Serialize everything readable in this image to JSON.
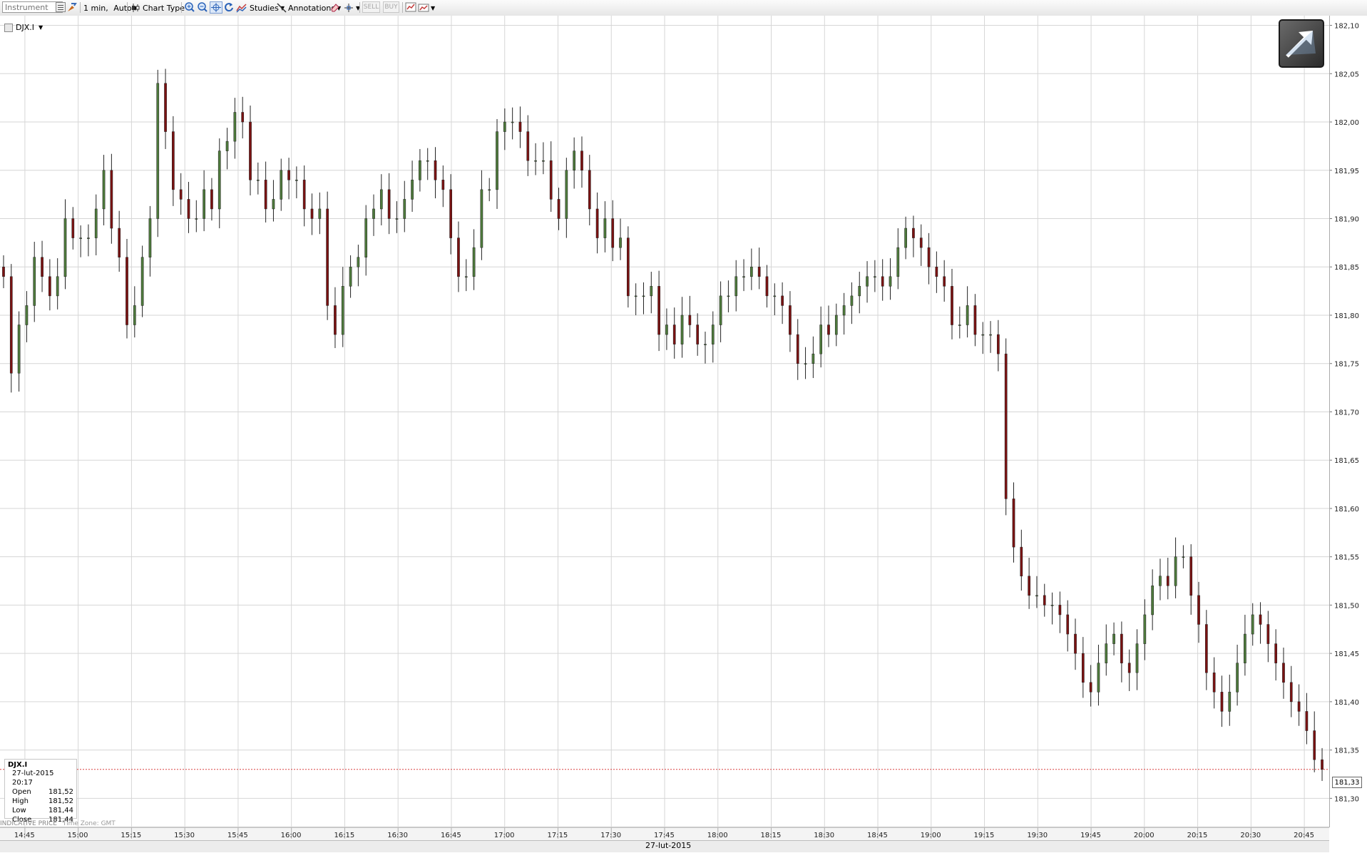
{
  "toolbar": {
    "instrument_placeholder": "Instrument",
    "interval_label": "1 min,",
    "auto_label": "Auto",
    "chart_type_label": "Chart Type",
    "studies_label": "Studies",
    "annotations_label": "Annotations",
    "sell_label": "SELL",
    "buy_label": "BUY"
  },
  "symbol": "DJX.I",
  "info_box": {
    "symbol": "DJX.I",
    "datetime": "27-lut-2015 20:17",
    "rows": [
      {
        "label": "Open",
        "value": "181,52"
      },
      {
        "label": "High",
        "value": "181,52"
      },
      {
        "label": "Low",
        "value": "181,44"
      },
      {
        "label": "Close",
        "value": "181,44"
      }
    ]
  },
  "footer": {
    "note": "INDICATIVE PRICE",
    "timezone": "Time Zone: GMT"
  },
  "date_label": "27-lut-2015",
  "last_price_label": "181,33",
  "colors": {
    "up": "#4e7a3c",
    "down": "#7a1212",
    "grid": "#d6d6d6",
    "last_price_line": "#d94040"
  },
  "chart_data": {
    "type": "ohlc-candlestick",
    "interval": "1 min",
    "last_price": 181.33,
    "y_axis": {
      "min": 181.27,
      "max": 182.11,
      "tick_labels": [
        "182,10",
        "182,05",
        "182,00",
        "181,95",
        "181,90",
        "181,85",
        "181,80",
        "181,75",
        "181,70",
        "181,65",
        "181,60",
        "181,55",
        "181,50",
        "181,45",
        "181,40",
        "181,35",
        "181,30"
      ],
      "tick_values": [
        182.1,
        182.05,
        182.0,
        181.95,
        181.9,
        181.85,
        181.8,
        181.75,
        181.7,
        181.65,
        181.6,
        181.55,
        181.5,
        181.45,
        181.4,
        181.35,
        181.3
      ]
    },
    "x_axis": {
      "tick_labels": [
        "14:45",
        "15:00",
        "15:15",
        "15:30",
        "15:45",
        "16:00",
        "16:15",
        "16:30",
        "16:45",
        "17:00",
        "17:15",
        "17:30",
        "17:45",
        "18:00",
        "18:15",
        "18:30",
        "18:45",
        "19:00",
        "19:15",
        "19:30",
        "19:45",
        "20:00",
        "20:15",
        "20:30",
        "20:45"
      ],
      "start": "14:38",
      "end": "20:52"
    },
    "closes": [
      [
        181.84,
        181.74,
        181.79,
        181.81,
        181.86,
        181.84,
        181.82,
        181.84,
        181.9,
        181.88,
        181.88,
        181.88,
        181.91,
        181.95,
        181.89,
        181.86,
        181.79,
        181.81,
        181.86,
        181.9,
        182.04,
        181.99,
        181.93,
        181.92,
        181.9,
        181.9,
        181.93,
        181.91,
        181.97,
        181.98,
        182.01,
        182.0,
        181.94,
        181.94,
        181.91,
        181.92,
        181.95,
        181.94,
        181.94,
        181.91,
        181.9,
        181.91,
        181.81,
        181.78,
        181.83,
        181.85,
        181.86,
        181.9,
        181.91,
        181.93
      ],
      [
        181.9,
        181.9,
        181.92,
        181.94,
        181.96,
        181.96,
        181.94,
        181.93,
        181.88,
        181.84,
        181.84,
        181.87,
        181.93,
        181.93,
        181.99,
        182.0,
        182.0,
        181.99,
        181.96,
        181.96,
        181.96,
        181.92,
        181.9,
        181.95,
        181.97,
        181.95,
        181.91,
        181.88,
        181.9,
        181.87,
        181.88,
        181.82,
        181.82,
        181.82,
        181.83,
        181.78,
        181.79,
        181.77,
        181.8,
        181.79,
        181.77,
        181.77,
        181.79,
        181.82,
        181.82,
        181.84,
        181.84,
        181.85,
        181.84,
        181.82
      ],
      [
        181.82,
        181.81,
        181.78,
        181.75,
        181.75,
        181.76,
        181.79,
        181.78,
        181.8,
        181.81,
        181.82,
        181.83,
        181.84,
        181.84,
        181.83,
        181.84,
        181.87,
        181.89,
        181.88,
        181.87,
        181.85,
        181.84,
        181.83,
        181.79,
        181.79,
        181.81,
        181.78,
        181.78,
        181.78,
        181.76,
        181.61,
        181.56,
        181.53,
        181.51,
        181.51,
        181.5,
        181.5,
        181.49,
        181.47,
        181.45,
        181.42,
        181.41,
        181.44,
        181.46,
        181.47,
        181.44,
        181.43,
        181.46,
        181.49,
        181.52
      ],
      [
        181.53,
        181.52,
        181.55,
        181.55,
        181.51,
        181.48,
        181.43,
        181.41,
        181.39,
        181.41,
        181.44,
        181.47,
        181.49,
        181.48,
        181.46,
        181.44,
        181.42,
        181.4,
        181.39,
        181.37,
        181.34,
        181.33
      ]
    ]
  }
}
